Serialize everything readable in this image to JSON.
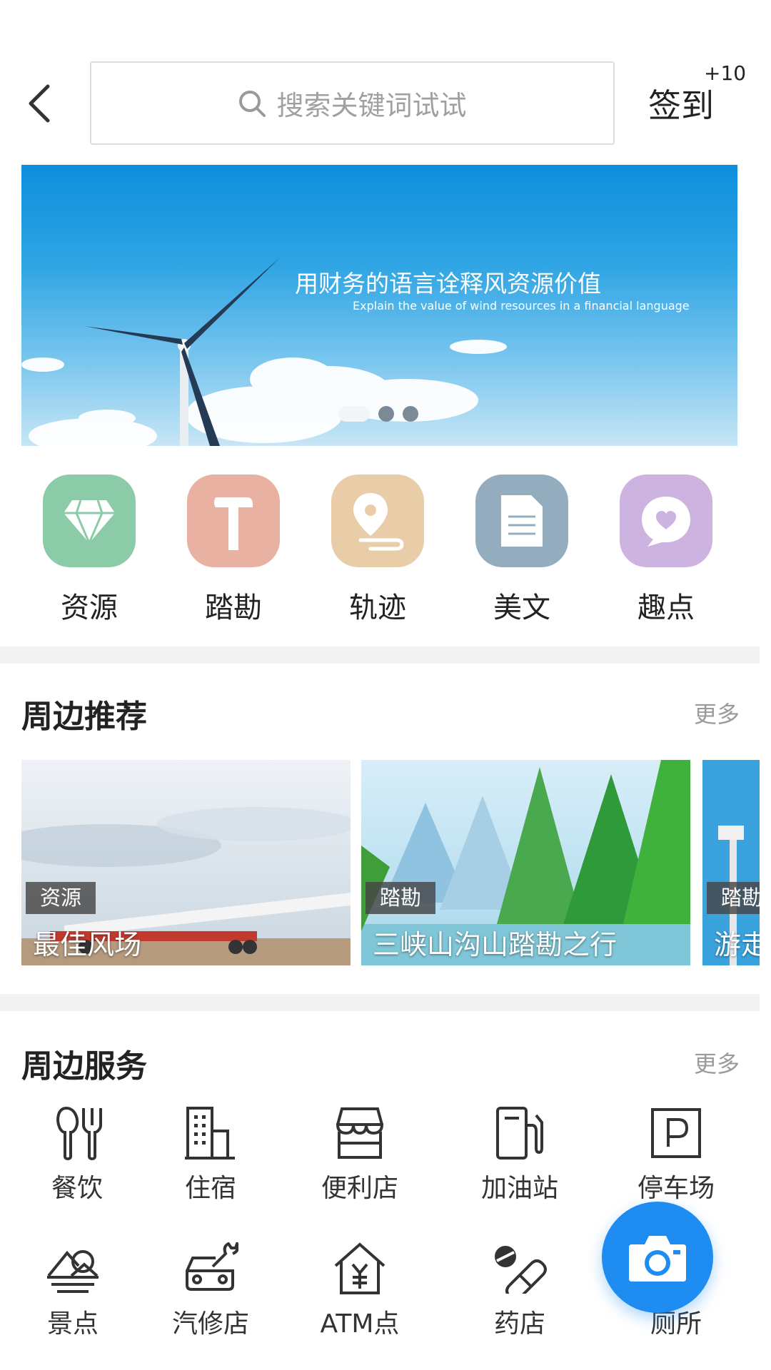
{
  "header": {
    "search_placeholder": "搜索关键词试试",
    "checkin_label": "签到",
    "checkin_bonus": "+10"
  },
  "banner": {
    "title": "用财务的语言诠释风资源价值",
    "subtitle": "Explain the value of wind resources in a financial language",
    "slide_count": 3,
    "active_slide": 1
  },
  "categories": [
    {
      "label": "资源",
      "icon": "diamond-icon",
      "color": "#8ccba8"
    },
    {
      "label": "踏勘",
      "icon": "hammer-icon",
      "color": "#e8b1a2"
    },
    {
      "label": "轨迹",
      "icon": "location-pin-icon",
      "color": "#e9cda9"
    },
    {
      "label": "美文",
      "icon": "document-icon",
      "color": "#93adbf"
    },
    {
      "label": "趣点",
      "icon": "heart-chat-icon",
      "color": "#cdb4e0"
    }
  ],
  "recommend": {
    "title": "周边推荐",
    "more": "更多",
    "cards": [
      {
        "tag": "资源",
        "title": "最佳风场"
      },
      {
        "tag": "踏勘",
        "title": "三峡山沟山踏勘之行"
      },
      {
        "tag": "踏勘",
        "title": "游走"
      }
    ]
  },
  "services": {
    "title": "周边服务",
    "more": "更多",
    "items": [
      {
        "label": "餐饮",
        "icon": "fork-knife-icon"
      },
      {
        "label": "住宿",
        "icon": "building-icon"
      },
      {
        "label": "便利店",
        "icon": "store-icon"
      },
      {
        "label": "加油站",
        "icon": "gas-station-icon"
      },
      {
        "label": "停车场",
        "icon": "parking-icon"
      },
      {
        "label": "景点",
        "icon": "scenery-icon"
      },
      {
        "label": "汽修店",
        "icon": "car-repair-icon"
      },
      {
        "label": "ATM点",
        "icon": "atm-icon"
      },
      {
        "label": "药店",
        "icon": "pill-icon"
      },
      {
        "label": "厕所",
        "icon": "toilet-icon"
      }
    ]
  },
  "fab": {
    "icon": "camera-icon",
    "color": "#1e8cf0"
  }
}
